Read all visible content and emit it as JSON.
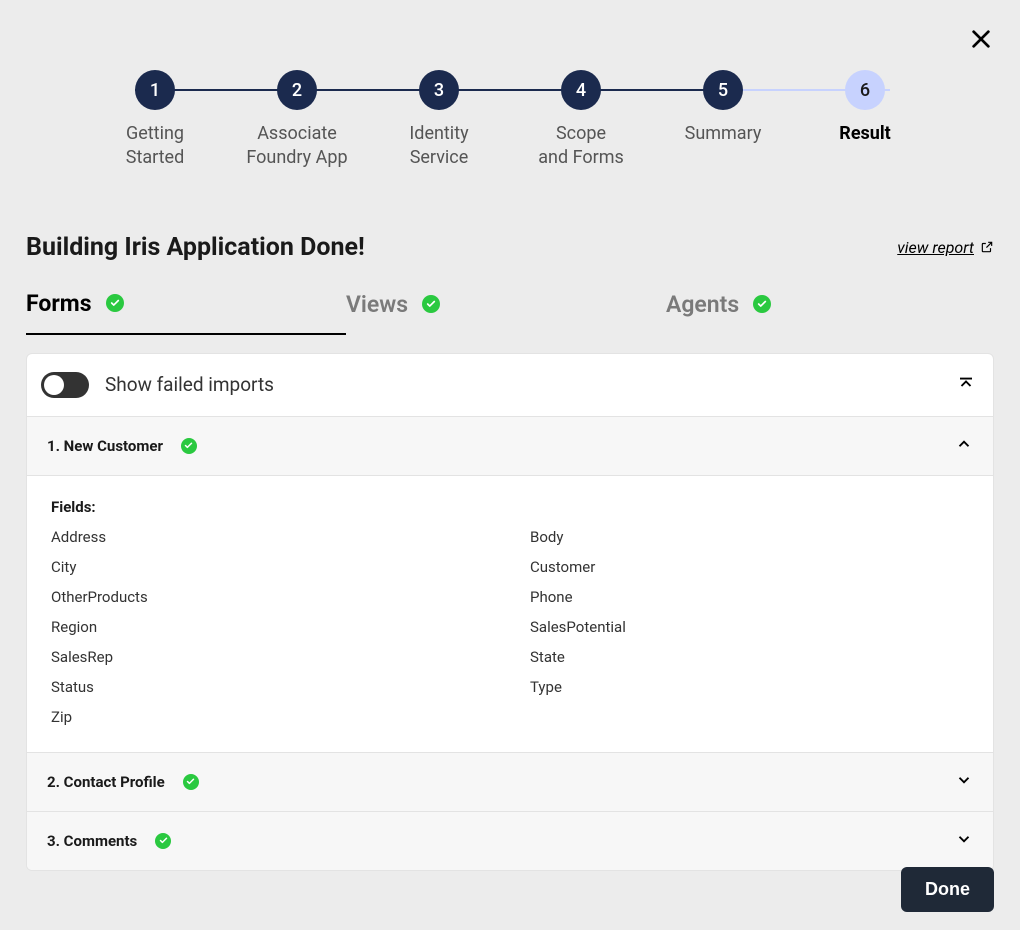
{
  "close_label": "Close",
  "stepper": [
    {
      "num": "1",
      "label": "Getting\nStarted",
      "active": false
    },
    {
      "num": "2",
      "label": "Associate\nFoundry App",
      "active": false
    },
    {
      "num": "3",
      "label": "Identity\nService",
      "active": false
    },
    {
      "num": "4",
      "label": "Scope\nand Forms",
      "active": false
    },
    {
      "num": "5",
      "label": "Summary",
      "active": false
    },
    {
      "num": "6",
      "label": "Result",
      "active": true
    }
  ],
  "heading": "Building Iris Application Done!",
  "view_report": "view report",
  "tabs": [
    {
      "label": "Forms",
      "active": true
    },
    {
      "label": "Views",
      "active": false
    },
    {
      "label": "Agents",
      "active": false
    }
  ],
  "toggle": {
    "label": "Show failed imports",
    "on": false
  },
  "fields_label": "Fields:",
  "items": [
    {
      "title": "1. New Customer",
      "expanded": true,
      "fields_left": [
        "Address",
        "City",
        "OtherProducts",
        "Region",
        "SalesRep",
        "Status",
        "Zip"
      ],
      "fields_right": [
        "Body",
        "Customer",
        "Phone",
        "SalesPotential",
        "State",
        "Type"
      ]
    },
    {
      "title": "2. Contact Profile",
      "expanded": false
    },
    {
      "title": "3. Comments",
      "expanded": false
    }
  ],
  "done_label": "Done"
}
